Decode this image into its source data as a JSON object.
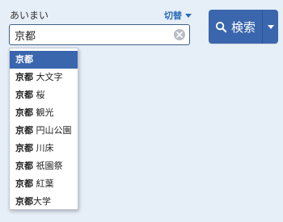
{
  "search_form": {
    "label": "あいまい",
    "switch_label": "切替",
    "input_value": "京都",
    "search_button_label": "検索"
  },
  "suggestions": [
    {
      "bold": "京都",
      "rest": ""
    },
    {
      "bold": "京都",
      "rest": " 大文字"
    },
    {
      "bold": "京都",
      "rest": " 桜"
    },
    {
      "bold": "京都",
      "rest": " 観光"
    },
    {
      "bold": "京都",
      "rest": " 円山公園"
    },
    {
      "bold": "京都",
      "rest": " 川床"
    },
    {
      "bold": "京都",
      "rest": " 祇園祭"
    },
    {
      "bold": "京都",
      "rest": " 紅葉"
    },
    {
      "bold": "京都",
      "rest": "大学"
    }
  ],
  "colors": {
    "background": "#e6eef8",
    "accent": "#3a66ad",
    "link": "#2b6bb5"
  },
  "icons": {
    "clear": "clear-icon",
    "search": "search-icon",
    "switch_caret": "caret-down-icon"
  }
}
